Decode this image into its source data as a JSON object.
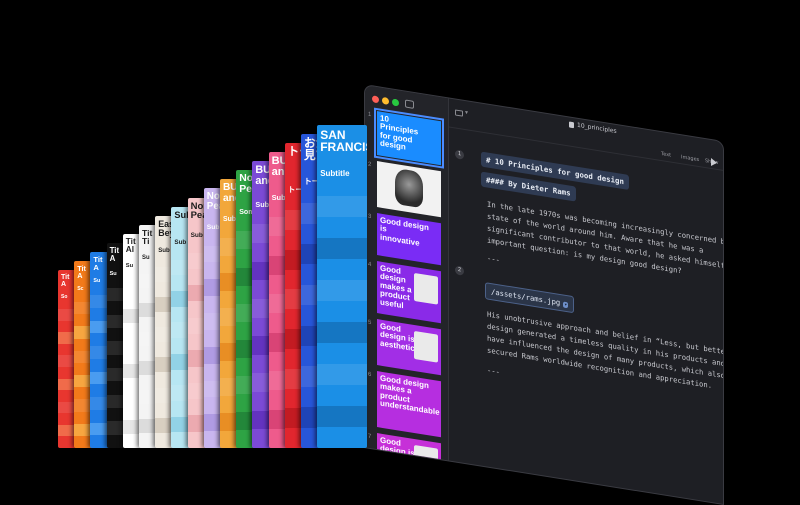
{
  "fan_decks": [
    {
      "bg": "#e8362f",
      "alt": "#f06b4a",
      "title": "Tit\nA",
      "sub": "So"
    },
    {
      "bg": "#f27a1a",
      "alt": "#f7a640",
      "title": "Tit\nA",
      "sub": "Sc"
    },
    {
      "bg": "#1f7ce5",
      "alt": "#4a9cf0",
      "title": "Tit\nA",
      "sub": "Su"
    },
    {
      "bg": "#111111",
      "alt": "#2a2a2a",
      "title": "Tit\nA",
      "sub": "Su"
    },
    {
      "bg": "#ffffff",
      "alt": "#e6e6e6",
      "title": "Tit\nAl",
      "sub": "Su",
      "dark": true
    },
    {
      "bg": "#f4f4f4",
      "alt": "#dcdcdc",
      "title": "Tit\nTi",
      "sub": "Su",
      "dark": true
    },
    {
      "bg": "#efe9df",
      "alt": "#d8cfc1",
      "title": "Eas\nBey",
      "sub": "Sub",
      "dark": true
    },
    {
      "bg": "#b7e6f2",
      "alt": "#92d2e6",
      "title": "Sub",
      "sub": "Sub",
      "dark": true
    },
    {
      "bg": "#f6c6c9",
      "alt": "#ecaab0",
      "title": "Nor\nPea",
      "sub": "Sub",
      "dark": true
    },
    {
      "bg": "#c9b6ef",
      "alt": "#b09be3",
      "title": "Nor\nPea",
      "sub": "Sub"
    },
    {
      "bg": "#f2a73b",
      "alt": "#e88e24",
      "title": "BUR\nand",
      "sub": "Sub"
    },
    {
      "bg": "#2ea344",
      "alt": "#23873a",
      "title": "Nor\nPea",
      "sub": "Som"
    },
    {
      "bg": "#7b4ad6",
      "alt": "#6333c0",
      "title": "BUR\nand",
      "sub": "Sub"
    },
    {
      "bg": "#ee5b8c",
      "alt": "#d94476",
      "title": "BUR\nand",
      "sub": "Sub"
    },
    {
      "bg": "#e1262e",
      "alt": "#c31b22",
      "title": "トーキ",
      "sub": "トー"
    },
    {
      "bg": "#2756d9",
      "alt": "#1f44b7",
      "title": "おかし\n見てい",
      "sub": "トー"
    },
    {
      "bg": "#1b8fe6",
      "alt": "#1576c2",
      "title": "SAN\nFRANCISC",
      "sub": "Subtitle"
    }
  ],
  "window": {
    "document_title": "10_principles",
    "toolbar_items": [
      "Text",
      "Images",
      "Show"
    ],
    "slides": [
      {
        "num": "1",
        "text": "10\nPrinciples\nfor good\ndesign",
        "bg": "#1a8cff"
      },
      {
        "num": "2",
        "text": "",
        "bg": "#f2f2f2"
      },
      {
        "num": "3",
        "text": "Good design\nis\ninnovative",
        "bg": "#7a2cf5"
      },
      {
        "num": "4",
        "text": "Good\ndesign\nmakes a\nproduct\nuseful",
        "bg": "#8a2ae8"
      },
      {
        "num": "5",
        "text": "Good\ndesign is\naesthetic",
        "bg": "#a22ee6"
      },
      {
        "num": "6",
        "text": "Good design\nmakes a\nproduct\nunderstandable",
        "bg": "#b62ee0"
      },
      {
        "num": "7",
        "text": "Good\ndesign is\nunobtrusive",
        "bg": "#c630d8"
      }
    ],
    "paragraph_numbers": [
      "1",
      "2"
    ],
    "heading": "# 10 Principles for good design",
    "author": "#### By Dieter Rams",
    "paragraph1": [
      "In the late 1970s was becoming increasingly concerned by the",
      "state of the world around him. Aware that he was a",
      "significant contributor to that world, he asked himself an",
      "important question: is my design good design?"
    ],
    "separator": "---",
    "image_path": "/assets/rams.jpg",
    "paragraph2": [
      "His unobtrusive approach and belief in “Less, but better”",
      "design generated a timeless quality in his products and",
      "have influenced the design of many products, which also",
      "secured Rams worldwide recognition and appreciation."
    ],
    "separator2": "---",
    "traffic_light_colors": [
      "#ff5f57",
      "#febc2e",
      "#28c840"
    ]
  }
}
